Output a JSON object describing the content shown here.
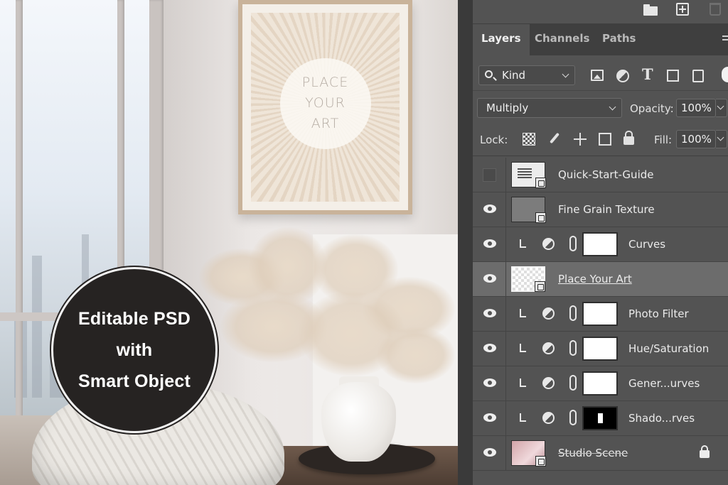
{
  "scene": {
    "frame_text": [
      "PLACE",
      "YOUR",
      "ART"
    ],
    "badge_lines": [
      "Editable PSD",
      "with",
      "Smart Object"
    ]
  },
  "panel": {
    "tabs": [
      {
        "label": "Layers",
        "active": true
      },
      {
        "label": "Channels",
        "active": false
      },
      {
        "label": "Paths",
        "active": false
      }
    ],
    "filter": {
      "kind_label": "Kind"
    },
    "blend_mode": "Multiply",
    "opacity_label": "Opacity:",
    "opacity_value": "100%",
    "lock_label": "Lock:",
    "fill_label": "Fill:",
    "fill_value": "100%",
    "layers": [
      {
        "name": "Quick-Start-Guide",
        "visible": false,
        "type": "smart-object"
      },
      {
        "name": "Fine Grain Texture",
        "visible": true,
        "type": "smart-object"
      },
      {
        "name": "Curves",
        "visible": true,
        "type": "adjustment",
        "clipped": true,
        "mask": "white"
      },
      {
        "name": "Place Your Art",
        "visible": true,
        "type": "smart-object",
        "selected": true
      },
      {
        "name": "Photo Filter",
        "visible": true,
        "type": "adjustment",
        "clipped": true,
        "mask": "white"
      },
      {
        "name": "Hue/Saturation",
        "visible": true,
        "type": "adjustment",
        "clipped": true,
        "mask": "white"
      },
      {
        "name": "Gener...urves",
        "visible": true,
        "type": "adjustment",
        "clipped": true,
        "mask": "white"
      },
      {
        "name": "Shado...rves",
        "visible": true,
        "type": "adjustment",
        "clipped": true,
        "mask": "dark"
      },
      {
        "name": "Studio Scene",
        "visible": true,
        "type": "smart-object",
        "locked": true
      }
    ]
  }
}
